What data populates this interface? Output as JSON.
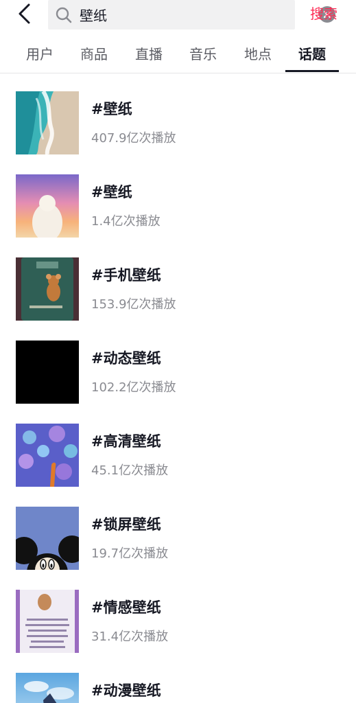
{
  "search": {
    "query": "壁纸",
    "submit_label": "搜索"
  },
  "tabs": [
    {
      "label": "用户"
    },
    {
      "label": "商品"
    },
    {
      "label": "直播"
    },
    {
      "label": "音乐"
    },
    {
      "label": "地点"
    },
    {
      "label": "话题"
    }
  ],
  "active_tab": "话题",
  "colors": {
    "accent": "#fe2c55",
    "title_text": "#161823",
    "secondary_text": "#8a8b91",
    "search_bg": "#f1f1f2"
  },
  "topics": [
    {
      "title": "#壁纸",
      "plays": "407.9亿次播放",
      "thumb": "ocean-beach"
    },
    {
      "title": "#壁纸",
      "plays": "1.4亿次播放",
      "thumb": "sunset-girl"
    },
    {
      "title": "#手机壁纸",
      "plays": "153.9亿次播放",
      "thumb": "lockscreen-cartoon-mouse"
    },
    {
      "title": "#动态壁纸",
      "plays": "102.2亿次播放",
      "thumb": "black"
    },
    {
      "title": "#高清壁纸",
      "plays": "45.1亿次播放",
      "thumb": "peacock"
    },
    {
      "title": "#锁屏壁纸",
      "plays": "19.7亿次播放",
      "thumb": "mickey-blue"
    },
    {
      "title": "#情感壁纸",
      "plays": "31.4亿次播放",
      "thumb": "text-quote-purple"
    },
    {
      "title": "#动漫壁纸",
      "plays": "",
      "thumb": "anime-sky"
    }
  ]
}
